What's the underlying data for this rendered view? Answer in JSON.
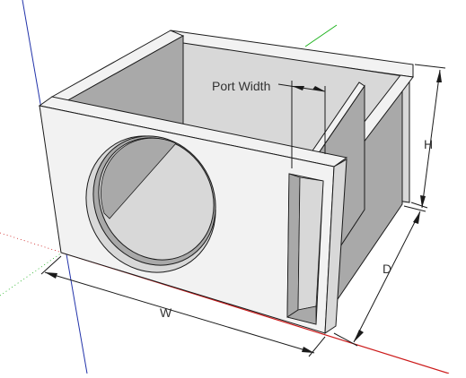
{
  "labels": {
    "port_width": "Port Width",
    "height": "H",
    "depth": "D",
    "width": "W"
  },
  "colors": {
    "background": "#ffffff",
    "face_light": "#f2f2f2",
    "face_mid": "#d8d8d8",
    "face_dark": "#a9a9a9",
    "face_darker": "#8e8e8e",
    "edge": "#1a1a1a",
    "axis_red": "#cc1a1a",
    "axis_green": "#1fb31f",
    "axis_blue": "#2233aa"
  }
}
